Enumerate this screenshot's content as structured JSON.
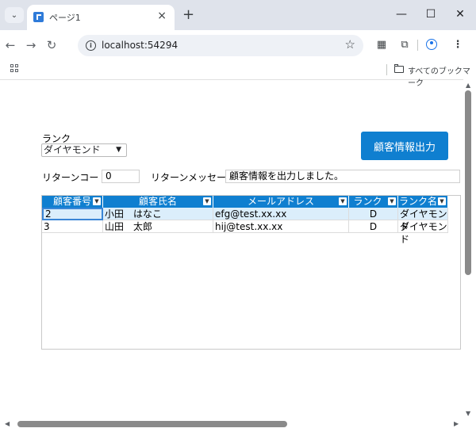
{
  "browser": {
    "tab_title": "ページ1",
    "tab_close": "×",
    "new_tab": "+",
    "menu_chevron": "⌄",
    "window_controls": {
      "minimize": "—",
      "maximize": "☐",
      "close": "✕"
    },
    "nav": {
      "back": "←",
      "forward": "→",
      "reload": "↻"
    },
    "url": "localhost:54294",
    "icons": [
      "info-icon",
      "star-icon",
      "qr-code-icon",
      "extensions-icon",
      "profile-icon",
      "more-icon",
      "apps-icon",
      "folder-icon"
    ],
    "all_bookmarks_label": "すべてのブックマーク"
  },
  "form": {
    "rank_label": "ランク",
    "rank_selected": "ダイヤモンド",
    "export_button": "顧客情報出力",
    "return_code_label": "リターンコード",
    "return_code_value": "0",
    "return_message_label": "リターンメッセージ",
    "return_message_value": "顧客情報を出力しました。"
  },
  "grid": {
    "columns": [
      "顧客番号",
      "顧客氏名",
      "メールアドレス",
      "ランク",
      "ランク名"
    ],
    "rows": [
      [
        "2",
        "小田　はなこ",
        "efg@test.xx.xx",
        "D",
        "ダイヤモンド"
      ],
      [
        "3",
        "山田　太郎",
        "hij@test.xx.xx",
        "D",
        "ダイヤモンド"
      ]
    ]
  },
  "colors": {
    "accent": "#0f7fd0",
    "selected_row": "#dbeefb",
    "tabstrip": "#dfe3eb"
  }
}
